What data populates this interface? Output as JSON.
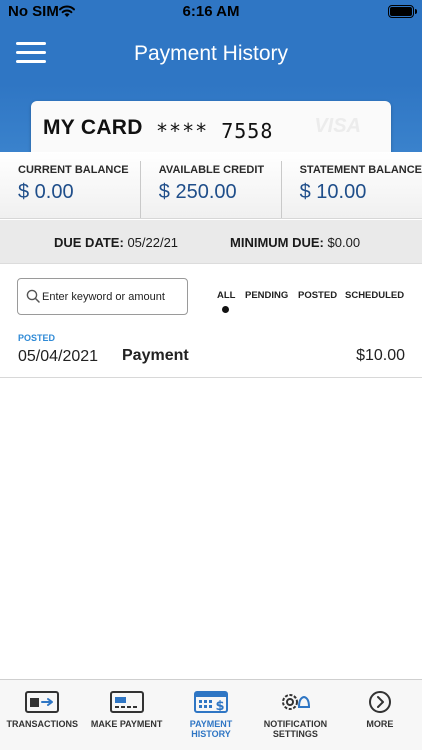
{
  "status_bar": {
    "carrier": "No SIM",
    "time": "6:16 AM"
  },
  "header": {
    "title": "Payment History"
  },
  "card": {
    "name": "MY CARD",
    "number": "**** 7558",
    "brand": "VISA"
  },
  "balances": [
    {
      "label": "CURRENT BALANCE",
      "value": "$ 0.00"
    },
    {
      "label": "AVAILABLE CREDIT",
      "value": "$ 250.00"
    },
    {
      "label": "STATEMENT BALANCE",
      "value": "$ 10.00"
    }
  ],
  "due": {
    "due_date_label": "DUE DATE:",
    "due_date_value": "05/22/21",
    "min_due_label": "MINIMUM DUE:",
    "min_due_value": "$0.00"
  },
  "search": {
    "placeholder": "Enter keyword or amount",
    "value": ""
  },
  "filters": {
    "items": [
      "ALL",
      "PENDING",
      "POSTED",
      "SCHEDULED"
    ],
    "selected": "ALL"
  },
  "transactions": [
    {
      "status": "POSTED",
      "date": "05/04/2021",
      "description": "Payment",
      "amount": "$10.00"
    }
  ],
  "tabs": [
    {
      "label": "TRANSACTIONS",
      "icon": "transactions-icon"
    },
    {
      "label": "MAKE PAYMENT",
      "icon": "card-icon"
    },
    {
      "label_line1": "PAYMENT",
      "label_line2": "HISTORY",
      "icon": "calendar-dollar-icon",
      "active": true
    },
    {
      "label_line1": "NOTIFICATION",
      "label_line2": "SETTINGS",
      "icon": "gear-bell-icon"
    },
    {
      "label": "MORE",
      "icon": "chevron-right-circle-icon"
    }
  ],
  "colors": {
    "primary": "#2f76c4",
    "accent_text": "#1f4e8a",
    "posted": "#2f8ad6"
  }
}
